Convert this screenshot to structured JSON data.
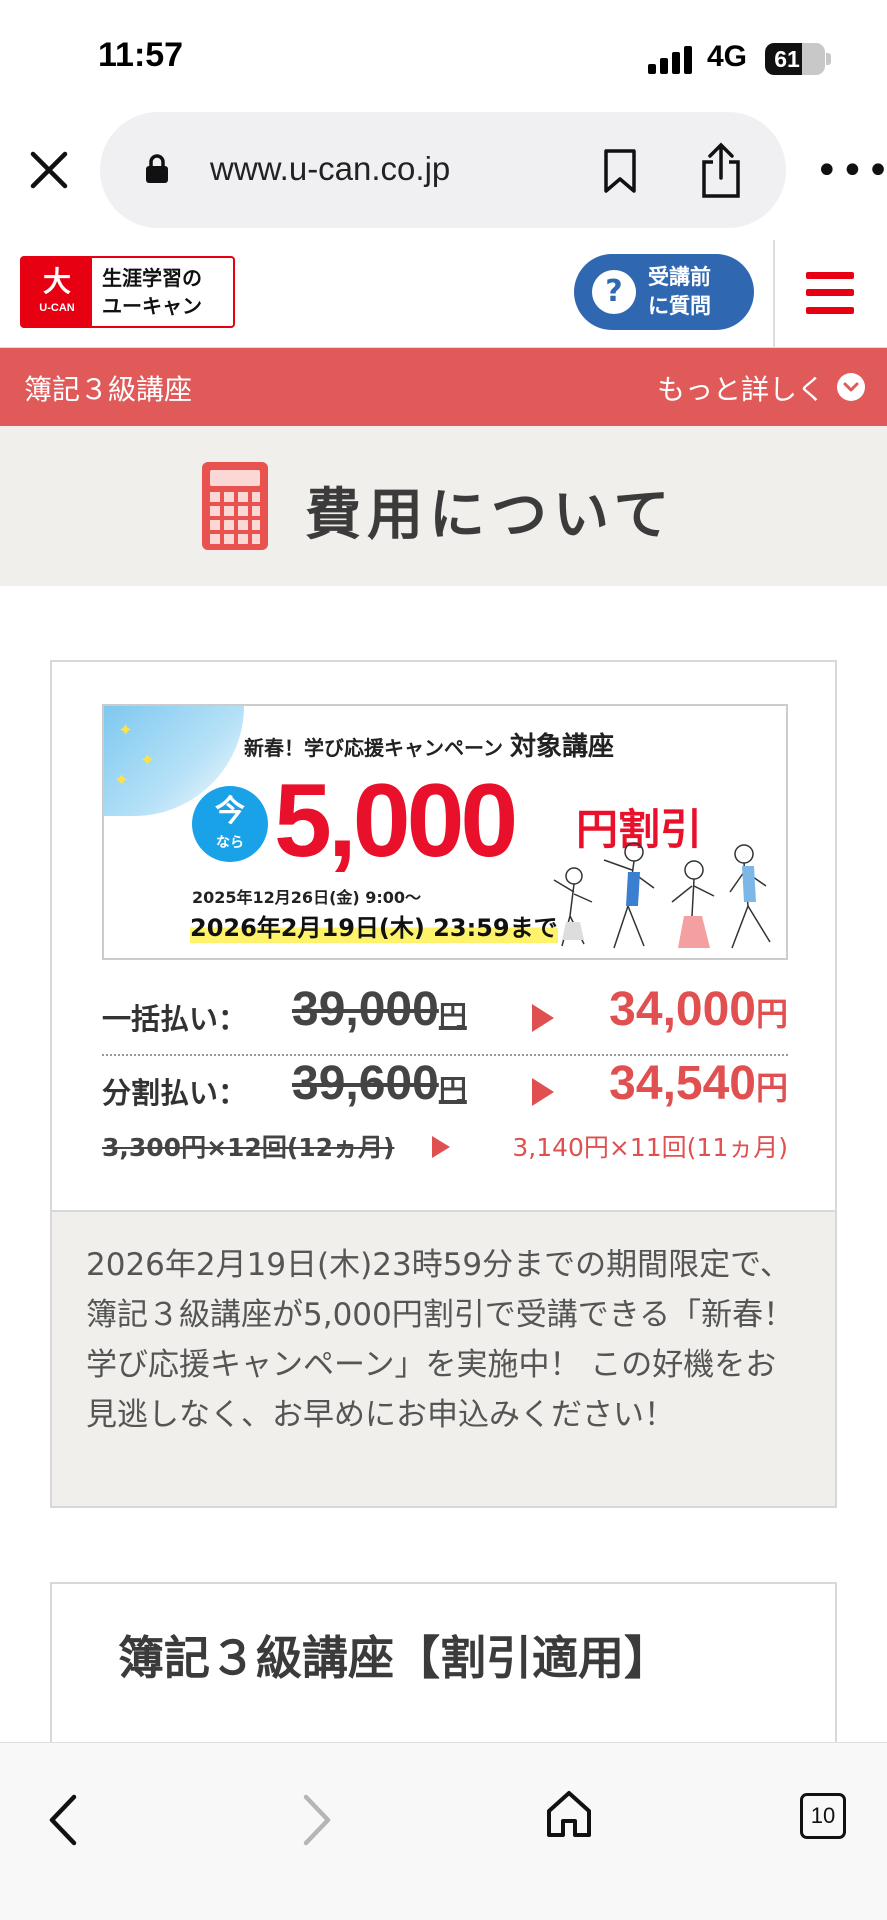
{
  "status": {
    "time": "11:57",
    "network": "4G",
    "battery_level": 61,
    "battery_text": "61"
  },
  "browser": {
    "url": "www.u-can.co.jp",
    "tab_count": "10"
  },
  "header": {
    "logo_kanji": "大",
    "logo_brand": "U-CAN",
    "logo_line1": "生涯学習の",
    "logo_line2": "ユーキャン",
    "ask_line1": "受講前",
    "ask_line2": "に質問",
    "ask_icon": "?"
  },
  "course_bar": {
    "title": "簿記３級講座",
    "more": "もっと詳しく"
  },
  "section": {
    "title": "費用について"
  },
  "banner": {
    "campaign": "新春！学び応援キャンペーン",
    "target": "対象講座",
    "now1": "今",
    "now2": "なら",
    "amount": "5,000",
    "unit": "円割引",
    "start": "2025年12月26日(金) 9:00～",
    "end": "2026年2月19日(木) 23:59まで"
  },
  "prices": {
    "lump_label": "一括払い：",
    "lump_old": "39,000",
    "lump_new": "34,000",
    "inst_label": "分割払い：",
    "inst_old": "39,600",
    "inst_new": "34,540",
    "yen": "円",
    "inst_old_detail": "3,300円×12回(12ヵ月)",
    "inst_new_detail": "3,140円×11回(11ヵ月)"
  },
  "note": "2026年2月19日(木)23時59分までの期間限定で、簿記３級講座が5,000円割引で受講できる「新春！ 学び応援キャンペーン」を実施中！ この好機をお見逃しなく、お早めにお申込みください！",
  "next_card": {
    "title": "簿記３級講座【割引適用】"
  },
  "colors": {
    "brand_red": "#e60012",
    "bar_red": "#e05a5a",
    "blue": "#2f67b0",
    "price_red": "#e05050"
  }
}
